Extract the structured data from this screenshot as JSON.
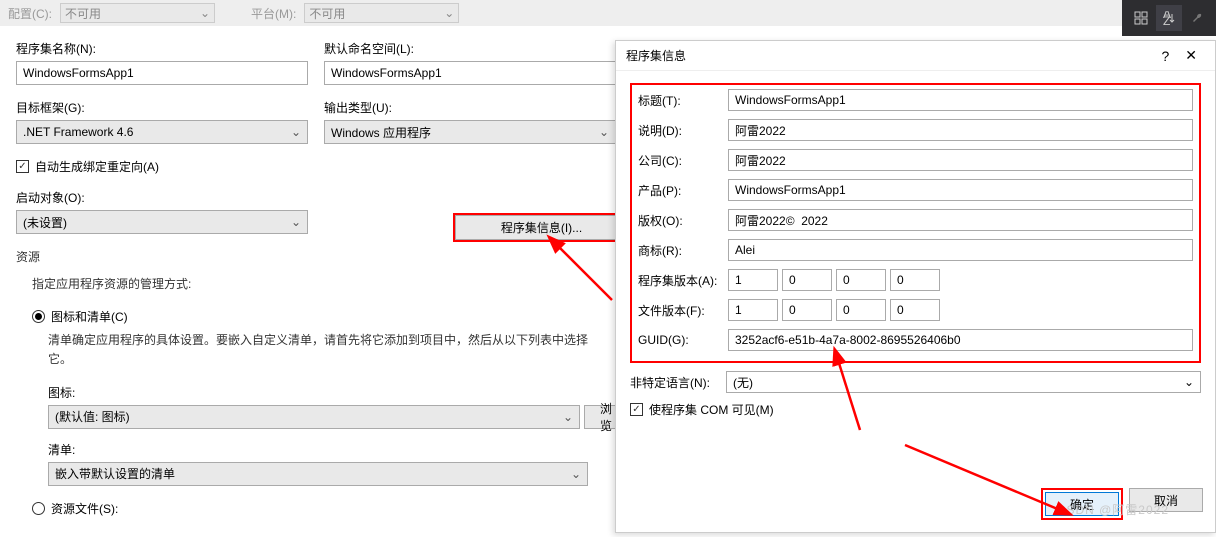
{
  "topbar": {
    "config_label": "配置(C):",
    "config_value": "不可用",
    "platform_label": "平台(M):",
    "platform_value": "不可用"
  },
  "left": {
    "assembly_name_label": "程序集名称(N):",
    "assembly_name_value": "WindowsFormsApp1",
    "default_ns_label": "默认命名空间(L):",
    "default_ns_value": "WindowsFormsApp1",
    "target_fw_label": "目标框架(G):",
    "target_fw_value": ".NET Framework 4.6",
    "output_type_label": "输出类型(U):",
    "output_type_value": "Windows 应用程序",
    "auto_redirect": "自动生成绑定重定向(A)",
    "startup_label": "启动对象(O):",
    "startup_value": "(未设置)",
    "assembly_info_btn": "程序集信息(I)...",
    "resources_title": "资源",
    "resources_desc": "指定应用程序资源的管理方式:",
    "icon_manifest_radio": "图标和清单(C)",
    "manifest_desc": "清单确定应用程序的具体设置。要嵌入自定义清单，请首先将它添加到项目中，然后从以下列表中选择它。",
    "icon_label": "图标:",
    "icon_value": "(默认值: 图标)",
    "browse": "浏览",
    "manifest_label": "清单:",
    "manifest_value": "嵌入带默认设置的清单",
    "resource_file_radio": "资源文件(S):"
  },
  "dialog": {
    "title": "程序集信息",
    "labels": {
      "title_f": "标题(T):",
      "desc": "说明(D):",
      "company": "公司(C):",
      "product": "产品(P):",
      "copyright": "版权(O):",
      "trademark": "商标(R):",
      "asm_ver": "程序集版本(A):",
      "file_ver": "文件版本(F):",
      "guid": "GUID(G):",
      "lang": "非特定语言(N):",
      "com": "使程序集 COM 可见(M)"
    },
    "values": {
      "title_f": "WindowsFormsApp1",
      "desc": "阿雷2022",
      "company": "阿雷2022",
      "product": "WindowsFormsApp1",
      "copyright": "阿雷2022©  2022",
      "trademark": "Alei",
      "asm_ver": [
        "1",
        "0",
        "0",
        "0"
      ],
      "file_ver": [
        "1",
        "0",
        "0",
        "0"
      ],
      "guid": "3252acf6-e51b-4a7a-8002-8695526406b0",
      "lang": "(无)"
    },
    "ok": "确定",
    "cancel": "取消"
  },
  "watermark": "CSDN @阿雷2022"
}
